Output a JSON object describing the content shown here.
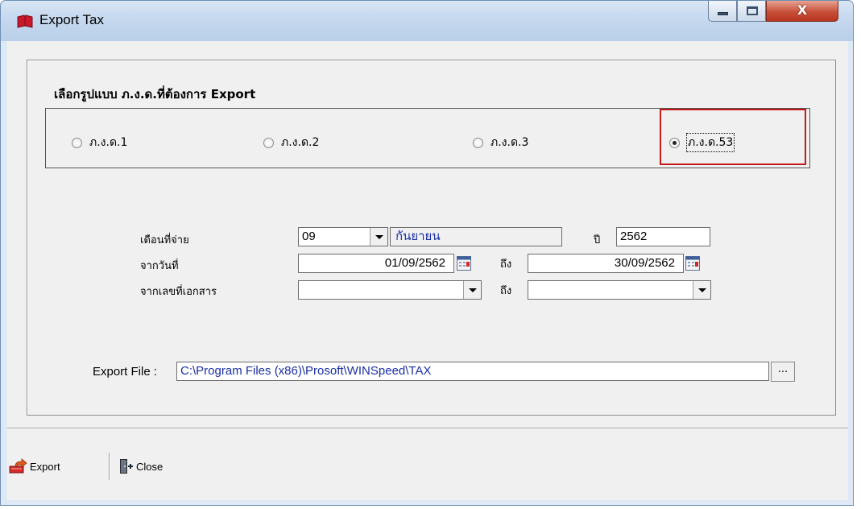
{
  "window": {
    "title": "Export Tax",
    "icon": "red-book-icon",
    "controls": {
      "minimize": "minimize-icon",
      "maximize": "maximize-icon",
      "close": "X"
    }
  },
  "section": {
    "title": "เลือกรูปแบบ ภ.ง.ด.ที่ต้องการ Export"
  },
  "radios": [
    {
      "label": "ภ.ง.ด.1",
      "checked": false
    },
    {
      "label": "ภ.ง.ด.2",
      "checked": false
    },
    {
      "label": "ภ.ง.ด.3",
      "checked": false
    },
    {
      "label": "ภ.ง.ด.53",
      "checked": true
    }
  ],
  "form": {
    "month_label": "เดือนที่จ่าย",
    "month_value": "09",
    "month_name": "กันยายน",
    "year_label": "ปี",
    "year_value": "2562",
    "from_date_label": "จากวันที่",
    "from_date": "01/09/2562",
    "to_label": "ถึง",
    "to_date": "30/09/2562",
    "doc_label": "จากเลขที่เอกสาร",
    "doc_from": "",
    "doc_to": ""
  },
  "export_file": {
    "label": "Export File :",
    "path": "C:\\Program Files (x86)\\Prosoft\\WINSpeed\\TAX",
    "browse_label": "..."
  },
  "toolbar": {
    "export_label": "Export",
    "close_label": "Close"
  },
  "colors": {
    "highlight": "#c21b1b",
    "value_text": "#1a2fa3"
  }
}
